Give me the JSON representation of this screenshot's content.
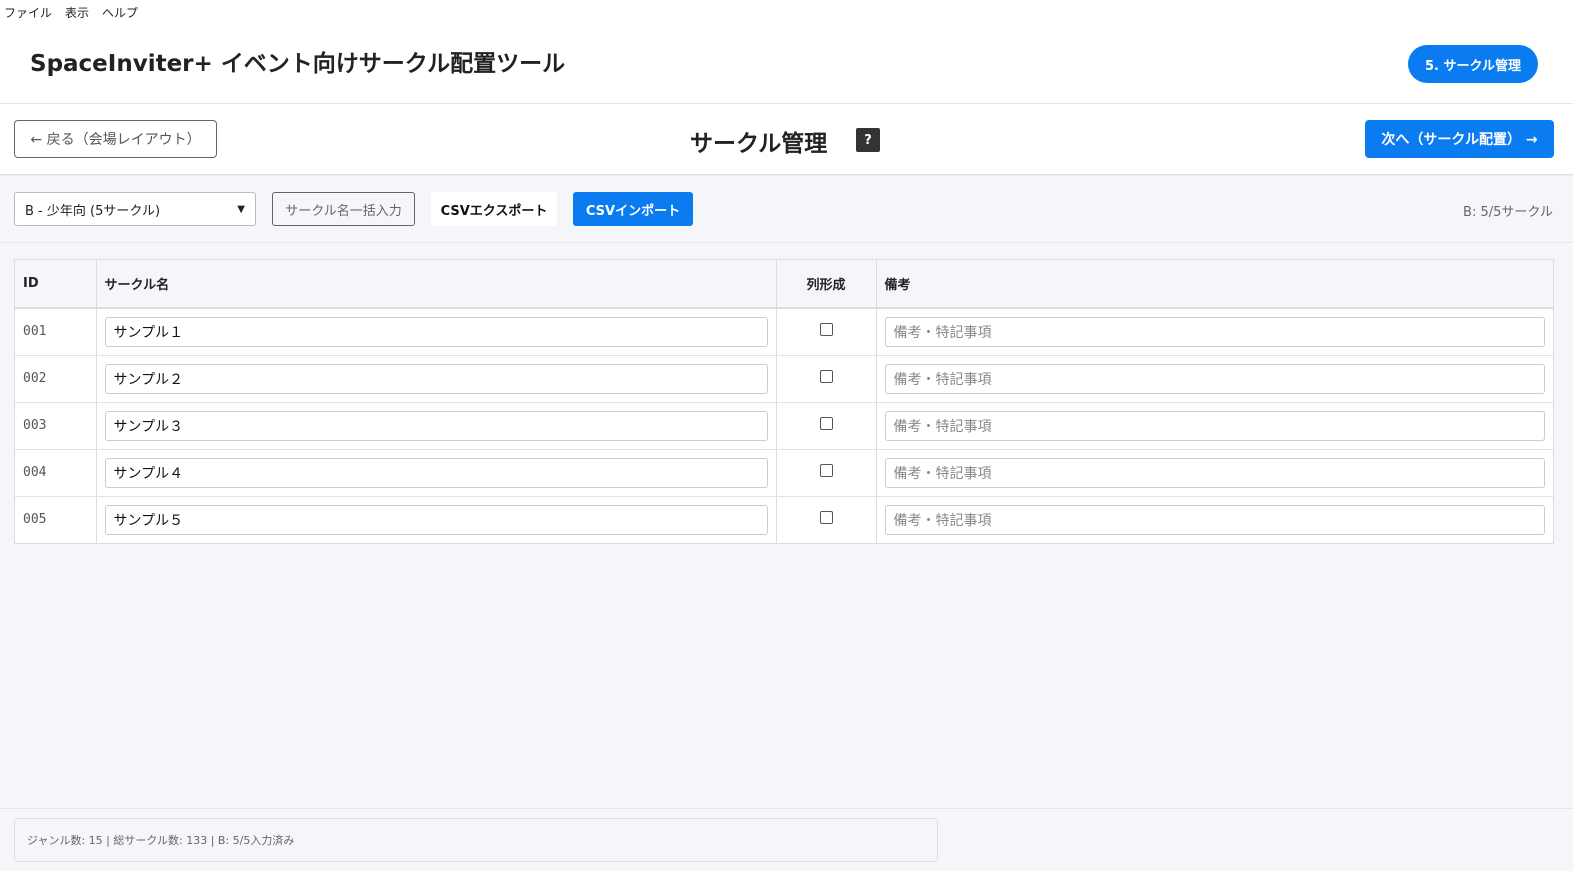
{
  "menu": {
    "file": "ファイル",
    "view": "表示",
    "help": "ヘルプ"
  },
  "header": {
    "app_title": "SpaceInviter+ イベント向けサークル配置ツール",
    "step_label": "5. サークル管理"
  },
  "nav": {
    "back_label": "← 戻る（会場レイアウト）",
    "page_title": "サークル管理",
    "help_label": "?",
    "next_label": "次へ（サークル配置） →"
  },
  "toolbar": {
    "genre_selected": "B - 少年向 (5サークル)",
    "bulk_label": "サークル名一括入力",
    "export_label": "CSVエクスポート",
    "import_label": "CSVインポート",
    "count_status": "B: 5/5サークル"
  },
  "table": {
    "headers": {
      "id": "ID",
      "name": "サークル名",
      "row_formation": "列形成",
      "note": "備考"
    },
    "note_placeholder": "備考・特記事項",
    "rows": [
      {
        "id": "001",
        "name": "サンプル１",
        "row_formation": false
      },
      {
        "id": "002",
        "name": "サンプル２",
        "row_formation": false
      },
      {
        "id": "003",
        "name": "サンプル３",
        "row_formation": false
      },
      {
        "id": "004",
        "name": "サンプル４",
        "row_formation": false
      },
      {
        "id": "005",
        "name": "サンプル５",
        "row_formation": false
      }
    ]
  },
  "footer": {
    "status": "ジャンル数: 15 | 総サークル数: 133 | B: 5/5入力済み"
  },
  "colors": {
    "accent": "#0a7cf0",
    "background": "#f5f6fa"
  },
  "icons": {
    "help": "question-mark-icon",
    "select_chevron": "chevron-down-icon"
  }
}
